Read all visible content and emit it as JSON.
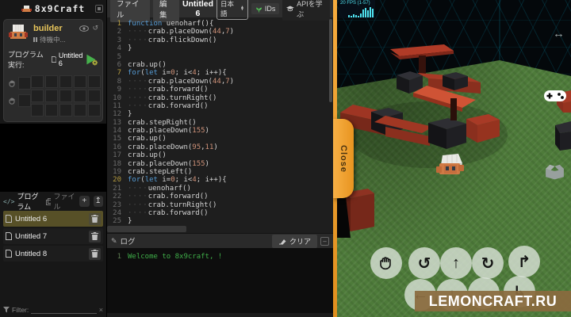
{
  "app": {
    "logo": "8x9Craft"
  },
  "colors": {
    "accent_orange": "#f2a33c",
    "selection_olive": "#575027",
    "play_green": "#46b14c",
    "log_green": "#3fae49",
    "keyword_blue": "#569cd6",
    "number_orange": "#ce9178",
    "wall_teal": "#0fb8d8",
    "grass_green": "#4e7b3a",
    "brick_red": "#a83a26",
    "watermark_brown": "#8a6b3f"
  },
  "sidebar": {
    "builder": {
      "name": "builder",
      "status": "待機中...",
      "run_label": "プログラム実行:",
      "run_file": "Untitled 6"
    },
    "inventory": {
      "left_rows": 2,
      "grid_cols": 5,
      "grid_rows": 3
    },
    "files": {
      "tab_program": "プログラム",
      "tab_file": "ファイル",
      "add_label": "+",
      "upload_label": "↥",
      "items": [
        {
          "name": "Untitled 6",
          "selected": true
        },
        {
          "name": "Untitled 7",
          "selected": false
        },
        {
          "name": "Untitled 8",
          "selected": false
        }
      ],
      "filter_label": "Filter:",
      "clear_filter": "×"
    }
  },
  "editor": {
    "menu_file": "ファイル",
    "menu_edit": "編集",
    "title": "Untitled 6",
    "language": "日本語",
    "ids_label": "IDs",
    "api_label": "APIを学ぶ",
    "lines": [
      {
        "n": "1",
        "gold": true,
        "toks": [
          [
            "kw",
            "function"
          ],
          [
            "pl",
            " uenoharf(){"
          ]
        ]
      },
      {
        "n": "2",
        "gold": false,
        "toks": [
          [
            "ws",
            "····"
          ],
          [
            "pl",
            "crab.placeDown("
          ],
          [
            "nu",
            "44"
          ],
          [
            "pl",
            ","
          ],
          [
            "nu",
            "7"
          ],
          [
            "pl",
            ")"
          ]
        ]
      },
      {
        "n": "3",
        "gold": false,
        "toks": [
          [
            "ws",
            "····"
          ],
          [
            "pl",
            "crab.flickDown()"
          ]
        ]
      },
      {
        "n": "4",
        "gold": false,
        "toks": [
          [
            "pl",
            "}"
          ]
        ]
      },
      {
        "n": "5",
        "gold": false,
        "toks": []
      },
      {
        "n": "6",
        "gold": false,
        "toks": [
          [
            "pl",
            "crab.up()"
          ]
        ]
      },
      {
        "n": "7",
        "gold": true,
        "toks": [
          [
            "kw",
            "for"
          ],
          [
            "pl",
            "("
          ],
          [
            "kw",
            "let"
          ],
          [
            "pl",
            " i="
          ],
          [
            "nu",
            "0"
          ],
          [
            "pl",
            "; i<"
          ],
          [
            "nu",
            "4"
          ],
          [
            "pl",
            "; i++){"
          ]
        ]
      },
      {
        "n": "8",
        "gold": false,
        "toks": [
          [
            "ws",
            "····"
          ],
          [
            "pl",
            "crab.placeDown("
          ],
          [
            "nu",
            "44"
          ],
          [
            "pl",
            ","
          ],
          [
            "nu",
            "7"
          ],
          [
            "pl",
            ")"
          ]
        ]
      },
      {
        "n": "9",
        "gold": false,
        "toks": [
          [
            "ws",
            "····"
          ],
          [
            "pl",
            "crab.forward()"
          ]
        ]
      },
      {
        "n": "10",
        "gold": false,
        "toks": [
          [
            "ws",
            "····"
          ],
          [
            "pl",
            "crab.turnRight()"
          ]
        ]
      },
      {
        "n": "11",
        "gold": false,
        "toks": [
          [
            "ws",
            "····"
          ],
          [
            "pl",
            "crab.forward()"
          ]
        ]
      },
      {
        "n": "12",
        "gold": false,
        "toks": [
          [
            "pl",
            "}"
          ]
        ]
      },
      {
        "n": "13",
        "gold": false,
        "toks": [
          [
            "pl",
            "crab.stepRight()"
          ]
        ]
      },
      {
        "n": "14",
        "gold": false,
        "toks": [
          [
            "pl",
            "crab.placeDown("
          ],
          [
            "nu",
            "155"
          ],
          [
            "pl",
            ")"
          ]
        ]
      },
      {
        "n": "15",
        "gold": false,
        "toks": [
          [
            "pl",
            "crab.up()"
          ]
        ]
      },
      {
        "n": "16",
        "gold": false,
        "toks": [
          [
            "pl",
            "crab.placeDown("
          ],
          [
            "nu",
            "95"
          ],
          [
            "pl",
            ","
          ],
          [
            "nu",
            "11"
          ],
          [
            "pl",
            ")"
          ]
        ]
      },
      {
        "n": "17",
        "gold": false,
        "toks": [
          [
            "pl",
            "crab.up()"
          ]
        ]
      },
      {
        "n": "18",
        "gold": false,
        "toks": [
          [
            "pl",
            "crab.placeDown("
          ],
          [
            "nu",
            "155"
          ],
          [
            "pl",
            ")"
          ]
        ]
      },
      {
        "n": "19",
        "gold": false,
        "toks": [
          [
            "pl",
            "crab.stepLeft()"
          ]
        ]
      },
      {
        "n": "20",
        "gold": true,
        "toks": [
          [
            "kw",
            "for"
          ],
          [
            "pl",
            "("
          ],
          [
            "kw",
            "let"
          ],
          [
            "pl",
            " i="
          ],
          [
            "nu",
            "0"
          ],
          [
            "pl",
            "; i<"
          ],
          [
            "nu",
            "4"
          ],
          [
            "pl",
            "; i++){"
          ]
        ]
      },
      {
        "n": "21",
        "gold": false,
        "toks": [
          [
            "ws",
            "····"
          ],
          [
            "pl",
            "uenoharf()"
          ]
        ]
      },
      {
        "n": "22",
        "gold": false,
        "toks": [
          [
            "ws",
            "····"
          ],
          [
            "pl",
            "crab.forward()"
          ]
        ]
      },
      {
        "n": "23",
        "gold": false,
        "toks": [
          [
            "ws",
            "····"
          ],
          [
            "pl",
            "crab.turnRight()"
          ]
        ]
      },
      {
        "n": "24",
        "gold": false,
        "toks": [
          [
            "ws",
            "····"
          ],
          [
            "pl",
            "crab.forward()"
          ]
        ]
      },
      {
        "n": "25",
        "gold": false,
        "toks": [
          [
            "pl",
            "}"
          ]
        ]
      }
    ]
  },
  "log": {
    "label": "ログ",
    "clear_label": "クリア",
    "entries": [
      {
        "n": "1",
        "text": "Welcome to 8x9craft, !"
      }
    ]
  },
  "game": {
    "fps_label": "20 FPS (1-57)",
    "fps_bars": [
      3,
      2,
      4,
      3,
      2,
      5,
      10,
      12,
      9,
      13,
      11
    ],
    "close_label": "Close",
    "watermark": "LEMONCRAFT.RU",
    "controls": {
      "row1": [
        "grab",
        "rotate-ccw",
        "move-up",
        "rotate-cw",
        "turn-up"
      ],
      "row2": [
        "move-left",
        "move-down",
        "move-right",
        "turn-down"
      ]
    }
  }
}
